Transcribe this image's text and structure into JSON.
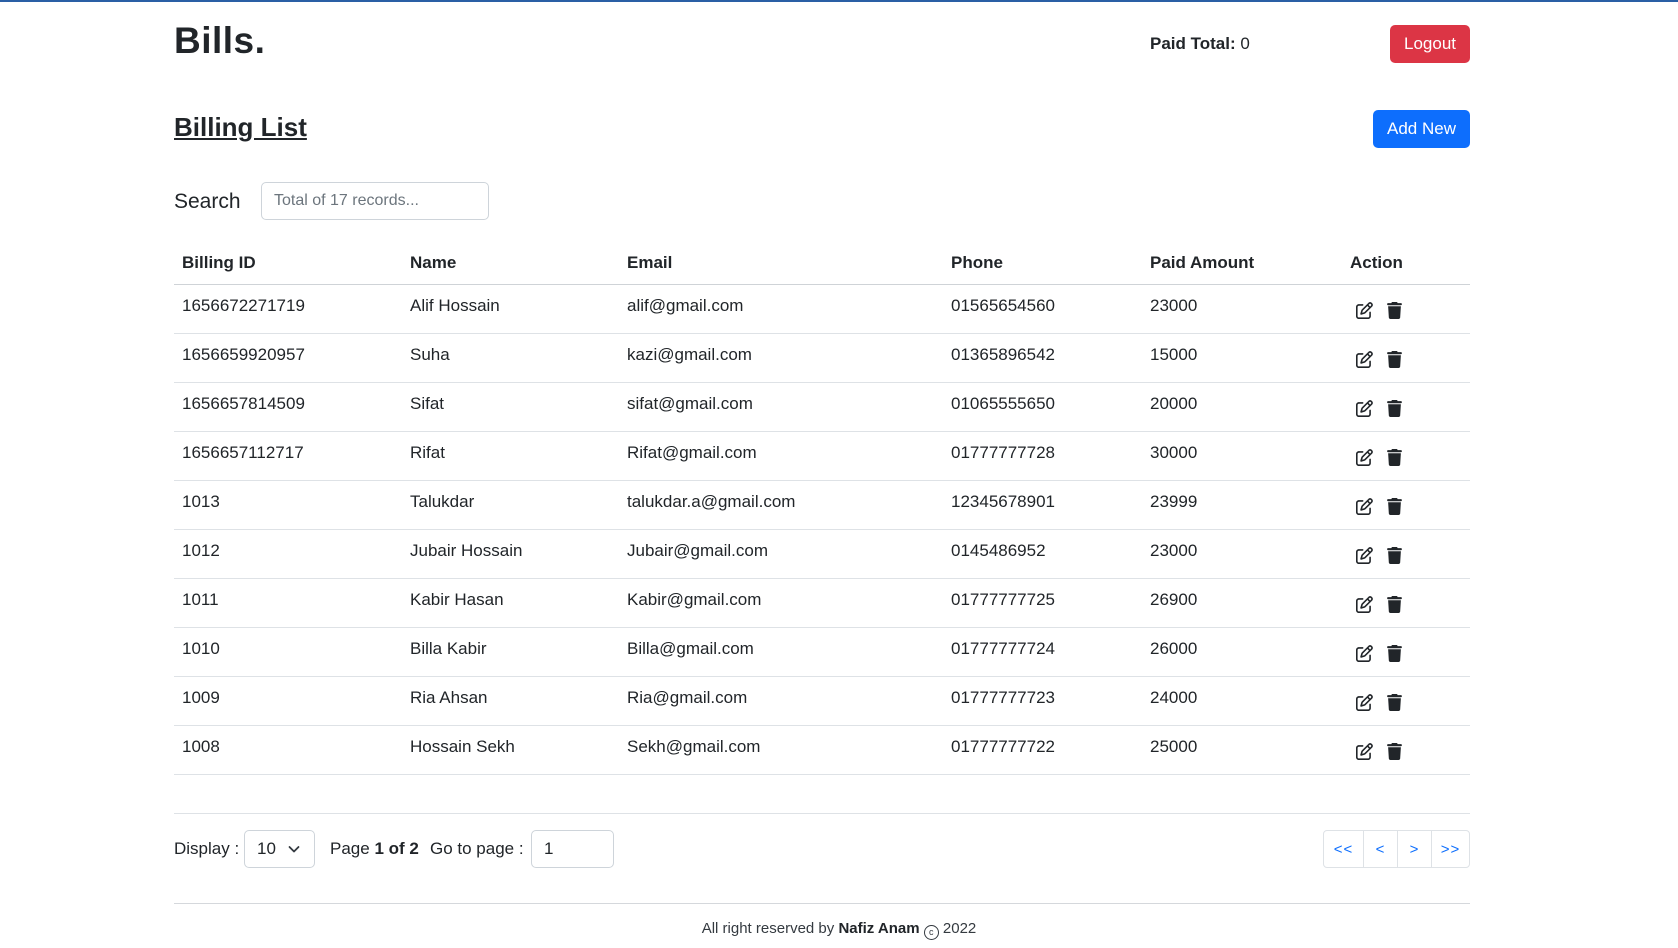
{
  "header": {
    "brand": "Bills.",
    "paid_total_label": "Paid Total:",
    "paid_total_value": "0",
    "logout_label": "Logout"
  },
  "page": {
    "title": "Billing List",
    "add_new_label": "Add New"
  },
  "search": {
    "label": "Search",
    "placeholder": "Total of 17 records..."
  },
  "table": {
    "columns": [
      "Billing ID",
      "Name",
      "Email",
      "Phone",
      "Paid Amount",
      "Action"
    ],
    "rows": [
      {
        "id": "1656672271719",
        "name": "Alif Hossain",
        "email": "alif@gmail.com",
        "phone": "01565654560",
        "amount": "23000"
      },
      {
        "id": "1656659920957",
        "name": "Suha",
        "email": "kazi@gmail.com",
        "phone": "01365896542",
        "amount": "15000"
      },
      {
        "id": "1656657814509",
        "name": "Sifat",
        "email": "sifat@gmail.com",
        "phone": "01065555650",
        "amount": "20000"
      },
      {
        "id": "1656657112717",
        "name": "Rifat",
        "email": "Rifat@gmail.com",
        "phone": "01777777728",
        "amount": "30000"
      },
      {
        "id": "1013",
        "name": "Talukdar",
        "email": "talukdar.a@gmail.com",
        "phone": "12345678901",
        "amount": "23999"
      },
      {
        "id": "1012",
        "name": "Jubair Hossain",
        "email": "Jubair@gmail.com",
        "phone": "0145486952",
        "amount": "23000"
      },
      {
        "id": "1011",
        "name": "Kabir Hasan",
        "email": "Kabir@gmail.com",
        "phone": "01777777725",
        "amount": "26900"
      },
      {
        "id": "1010",
        "name": "Billa Kabir",
        "email": "Billa@gmail.com",
        "phone": "01777777724",
        "amount": "26000"
      },
      {
        "id": "1009",
        "name": "Ria Ahsan",
        "email": "Ria@gmail.com",
        "phone": "01777777723",
        "amount": "24000"
      },
      {
        "id": "1008",
        "name": "Hossain Sekh",
        "email": "Sekh@gmail.com",
        "phone": "01777777722",
        "amount": "25000"
      }
    ],
    "action_icons": [
      "edit-icon",
      "trash-icon"
    ]
  },
  "pagination": {
    "display_label": "Display :",
    "display_value": "10",
    "page_prefix": "Page",
    "page_current_of_total": "1 of 2",
    "goto_label": "Go to page :",
    "goto_value": "1",
    "buttons": {
      "first": "<<",
      "prev": "<",
      "next": ">",
      "last": ">>"
    }
  },
  "footer": {
    "prefix": "All right reserved by",
    "author": "Nafiz Anam",
    "copyright_symbol": "c",
    "year": "2022"
  },
  "colors": {
    "logout": "#dc3545",
    "primary": "#0d6efd",
    "top_border": "#2a5fa5"
  }
}
